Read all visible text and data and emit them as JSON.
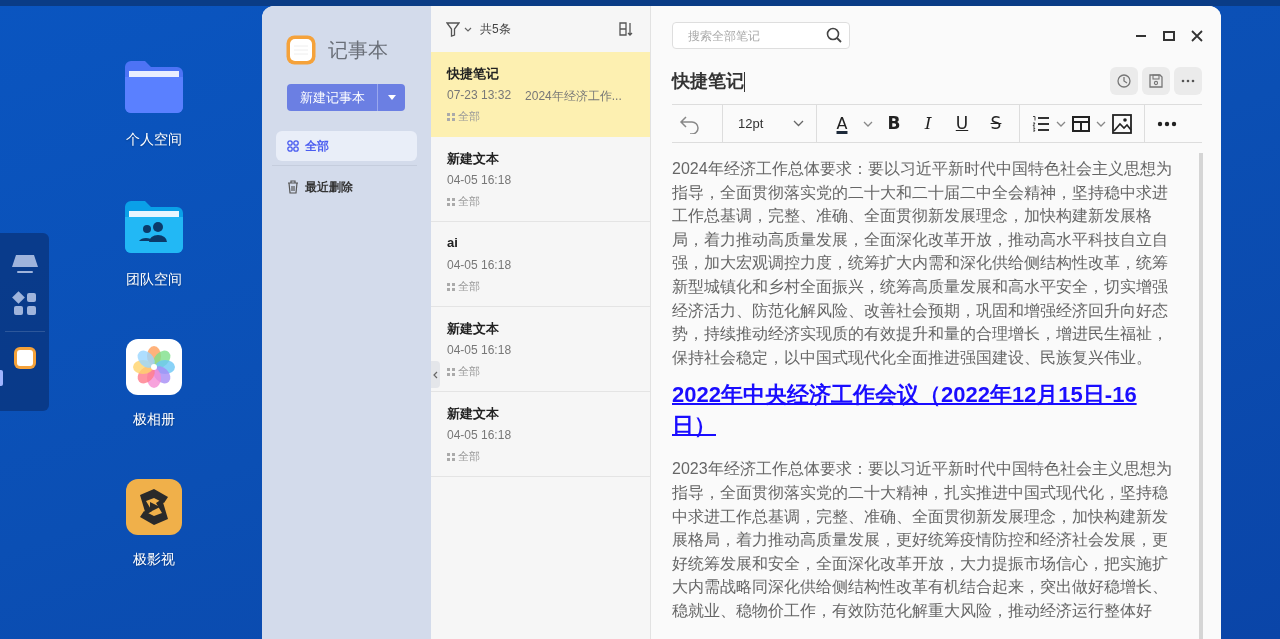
{
  "desktop": {
    "icons": [
      {
        "label": "个人空间",
        "kind": "folder"
      },
      {
        "label": "团队空间",
        "kind": "team"
      },
      {
        "label": "极相册",
        "kind": "photos"
      },
      {
        "label": "极影视",
        "kind": "video"
      }
    ]
  },
  "app": {
    "name": "记事本",
    "new_button": "新建记事本",
    "nav": [
      {
        "label": "全部",
        "kind": "all",
        "selected": true
      },
      {
        "label": "最近删除",
        "kind": "trash",
        "selected": false
      }
    ]
  },
  "note_list": {
    "count": "共5条",
    "notes": [
      {
        "title": "快捷笔记",
        "time": "07-23 13:32",
        "preview": "2024年经济工作...",
        "folder": "全部",
        "selected": true
      },
      {
        "title": "新建文本",
        "time": "04-05 16:18",
        "folder": "全部",
        "selected": false
      },
      {
        "title": "ai",
        "time": "04-05 16:18",
        "folder": "全部",
        "selected": false
      },
      {
        "title": "新建文本",
        "time": "04-05 16:18",
        "folder": "全部",
        "selected": false
      },
      {
        "title": "新建文本",
        "time": "04-05 16:18",
        "folder": "全部",
        "selected": false
      }
    ]
  },
  "editor": {
    "search": {
      "placeholder": "搜索全部笔记"
    },
    "title": "快捷笔记",
    "font_size": "12pt",
    "format": [
      {
        "kind": "color",
        "glyph": "A"
      },
      {
        "kind": "bold",
        "glyph": "B"
      },
      {
        "kind": "italic",
        "glyph": "I"
      },
      {
        "kind": "underline",
        "glyph": "U"
      },
      {
        "kind": "strike",
        "glyph": "S"
      }
    ],
    "content": [
      {
        "kind": "paragraph",
        "text": "2024年经济工作总体要求：要以习近平新时代中国特色社会主义思想为指导，全面贯彻落实党的二十大和二十届二中全会精神，坚持稳中求进工作总基调，完整、准确、全面贯彻新发展理念，加快构建新发展格局，着力推动高质量发展，全面深化改革开放，推动高水平科技自立自强，加大宏观调控力度，统筹扩大内需和深化供给侧结构性改革，统筹新型城镇化和乡村全面振兴，统筹高质量发展和高水平安全，切实增强经济活力、防范化解风险、改善社会预期，巩固和增强经济回升向好态势，持续推动经济实现质的有效提升和量的合理增长，增进民生福祉，保持社会稳定，以中国式现代化全面推进强国建设、民族复兴伟业。"
      },
      {
        "kind": "link_heading",
        "text": "2022年中央经济工作会议（2022年12月15日-16日）"
      },
      {
        "kind": "paragraph",
        "text": "2023年经济工作总体要求：要以习近平新时代中国特色社会主义思想为指导，全面贯彻落实党的二十大精神，扎实推进中国式现代化，坚持稳中求进工作总基调，完整、准确、全面贯彻新发展理念，加快构建新发展格局，着力推动高质量发展，更好统筹疫情防控和经济社会发展，更好统筹发展和安全，全面深化改革开放，大力提振市场信心，把实施扩大内需战略同深化供给侧结构性改革有机结合起来，突出做好稳增长、稳就业、稳物价工作，有效防范化解重大风险，推动经济运行整体好"
      }
    ]
  }
}
